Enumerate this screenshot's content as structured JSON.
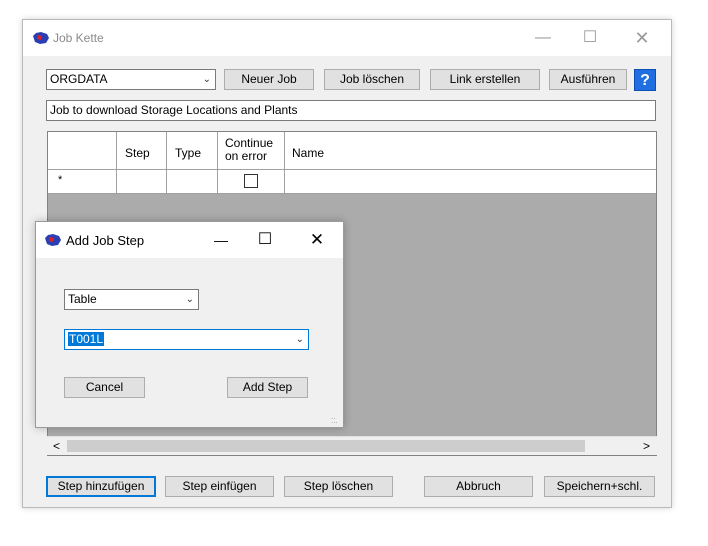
{
  "main": {
    "title": "Job Kette",
    "job_select": {
      "value": "ORGDATA"
    },
    "buttons": {
      "new_job": "Neuer Job",
      "delete_job": "Job löschen",
      "create_link": "Link erstellen",
      "run": "Ausführen",
      "help": "?"
    },
    "description": "Job to download Storage Locations and Plants",
    "grid": {
      "columns": [
        "",
        "Step",
        "Type",
        "Continue\non error",
        "Name"
      ],
      "new_row_marker": "*"
    },
    "bottom_buttons": {
      "add_step": "Step hinzufügen",
      "insert_step": "Step einfügen",
      "delete_step": "Step löschen",
      "cancel": "Abbruch",
      "save_close": "Speichern+schl."
    },
    "scroll": {
      "left": "<",
      "right": ">"
    }
  },
  "dialog": {
    "title": "Add Job Step",
    "type_select": {
      "value": "Table"
    },
    "table_select": {
      "value": "T001L"
    },
    "buttons": {
      "cancel": "Cancel",
      "add_step": "Add Step"
    }
  },
  "colors": {
    "accent": "#0078d7",
    "help_blue": "#1f6fe0",
    "grid_bg": "#ababab"
  }
}
